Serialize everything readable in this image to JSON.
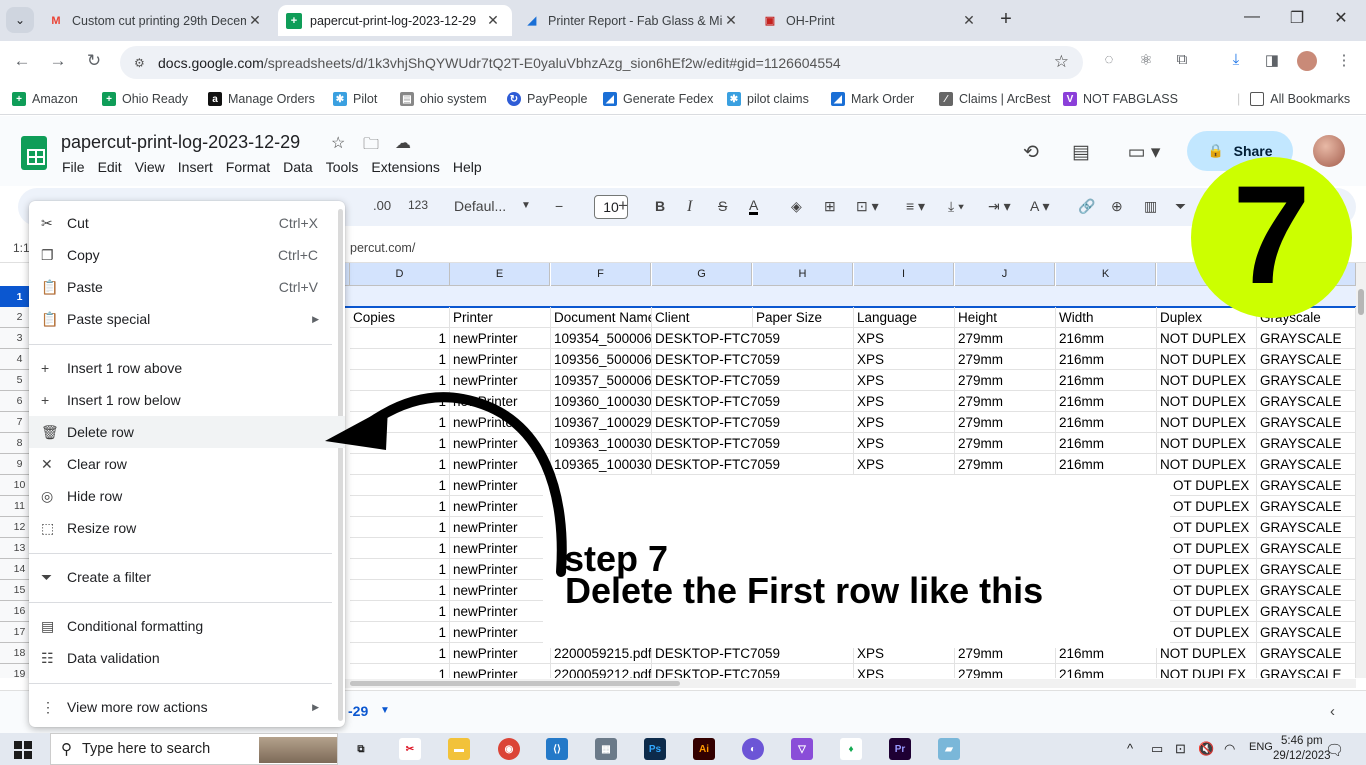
{
  "browser": {
    "tabs": [
      {
        "title": "Custom cut printing 29th Decem",
        "active": false
      },
      {
        "title": "papercut-print-log-2023-12-29",
        "active": true
      },
      {
        "title": "Printer Report - Fab Glass & Mi",
        "active": false
      },
      {
        "title": "OH-Print",
        "active": false
      }
    ],
    "address": {
      "host": "docs.google.com",
      "path": "/spreadsheets/d/1k3vhjShQYWUdr7tQ2T-E0yaluVbhzAzg_sion6hEf2w/edit#gid=1126604554"
    },
    "bookmarks": [
      "Amazon",
      "Ohio Ready",
      "Manage Orders",
      "Pilot",
      "ohio system",
      "PayPeople",
      "Generate Fedex",
      "pilot claims",
      "Mark Order",
      "Claims | ArcBest",
      "NOT FABGLASS"
    ],
    "all_bookmarks": "All Bookmarks"
  },
  "sheets": {
    "doc_title": "papercut-print-log-2023-12-29",
    "menu": [
      "File",
      "Edit",
      "View",
      "Insert",
      "Format",
      "Data",
      "Tools",
      "Extensions",
      "Help"
    ],
    "share_label": "Share",
    "toolbar": {
      "decimal": ".00",
      "number_format": "123",
      "font": "Defaul...",
      "font_size": "10"
    },
    "name_box": "1:1",
    "formula_text": "percut.com/",
    "columns": [
      "D",
      "E",
      "F",
      "G",
      "H",
      "I",
      "J",
      "K"
    ],
    "row_numbers": [
      "1",
      "2",
      "3",
      "4",
      "5",
      "6",
      "7",
      "8",
      "9",
      "10",
      "11",
      "12",
      "13",
      "14",
      "15",
      "16",
      "17",
      "18",
      "19"
    ],
    "header_row": [
      "Copies",
      "Printer",
      "Document Name",
      "Client",
      "Paper Size",
      "Language",
      "Height",
      "Width",
      "Duplex",
      "Grayscale"
    ],
    "full_rows": [
      [
        "1",
        "newPrinter",
        "109354_500006",
        "DESKTOP-FTC7059",
        "XPS",
        "279mm",
        "216mm",
        "NOT DUPLEX",
        "GRAYSCALE"
      ],
      [
        "1",
        "newPrinter",
        "109356_500006",
        "DESKTOP-FTC7059",
        "XPS",
        "279mm",
        "216mm",
        "NOT DUPLEX",
        "GRAYSCALE"
      ],
      [
        "1",
        "newPrinter",
        "109357_500006",
        "DESKTOP-FTC7059",
        "XPS",
        "279mm",
        "216mm",
        "NOT DUPLEX",
        "GRAYSCALE"
      ],
      [
        "1",
        "newPrinter",
        "109360_100030",
        "DESKTOP-FTC7059",
        "XPS",
        "279mm",
        "216mm",
        "NOT DUPLEX",
        "GRAYSCALE"
      ],
      [
        "1",
        "newPrinter",
        "109367_100029",
        "DESKTOP-FTC7059",
        "XPS",
        "279mm",
        "216mm",
        "NOT DUPLEX",
        "GRAYSCALE"
      ],
      [
        "1",
        "newPrinter",
        "109363_100030",
        "DESKTOP-FTC7059",
        "XPS",
        "279mm",
        "216mm",
        "NOT DUPLEX",
        "GRAYSCALE"
      ],
      [
        "1",
        "newPrinter",
        "109365_100030",
        "DESKTOP-FTC7059",
        "XPS",
        "279mm",
        "216mm",
        "NOT DUPLEX",
        "GRAYSCALE"
      ]
    ],
    "partial_rows": [
      [
        "1",
        "newPrinter",
        "OT DUPLEX",
        "GRAYSCALE"
      ],
      [
        "1",
        "newPrinter",
        "OT DUPLEX",
        "GRAYSCALE"
      ],
      [
        "1",
        "newPrinter",
        "OT DUPLEX",
        "GRAYSCALE"
      ],
      [
        "1",
        "newPrinter",
        "OT DUPLEX",
        "GRAYSCALE"
      ],
      [
        "1",
        "newPrinter",
        "OT DUPLEX",
        "GRAYSCALE"
      ],
      [
        "1",
        "newPrinter",
        "OT DUPLEX",
        "GRAYSCALE"
      ],
      [
        "1",
        "newPrinter",
        "OT DUPLEX",
        "GRAYSCALE"
      ],
      [
        "1",
        "newPrinter",
        "OT DUPLEX",
        "GRAYSCALE"
      ]
    ],
    "bottom_rows": [
      [
        "1",
        "newPrinter",
        "2200059215.pdf",
        "DESKTOP-FTC7059",
        "XPS",
        "279mm",
        "216mm",
        "NOT DUPLEX",
        "GRAYSCALE"
      ],
      [
        "1",
        "newPrinter",
        "2200059212.pdf",
        "DESKTOP-FTC7059",
        "XPS",
        "279mm",
        "216mm",
        "NOT DUPLEX",
        "GRAYSCALE"
      ]
    ],
    "sheet_tab": "-29"
  },
  "context_menu": {
    "items": [
      {
        "label": "Cut",
        "shortcut": "Ctrl+X",
        "icon": "cut-icon"
      },
      {
        "label": "Copy",
        "shortcut": "Ctrl+C",
        "icon": "copy-icon"
      },
      {
        "label": "Paste",
        "shortcut": "Ctrl+V",
        "icon": "paste-icon"
      },
      {
        "label": "Paste special",
        "shortcut": "",
        "icon": "paste-special-icon",
        "submenu": true
      },
      {
        "label": "Insert 1 row above",
        "shortcut": "",
        "icon": "plus-icon"
      },
      {
        "label": "Insert 1 row below",
        "shortcut": "",
        "icon": "plus-icon"
      },
      {
        "label": "Delete row",
        "shortcut": "",
        "icon": "trash-icon",
        "highlighted": true
      },
      {
        "label": "Clear row",
        "shortcut": "",
        "icon": "x-icon"
      },
      {
        "label": "Hide row",
        "shortcut": "",
        "icon": "eye-off-icon"
      },
      {
        "label": "Resize row",
        "shortcut": "",
        "icon": "resize-icon"
      },
      {
        "label": "Create a filter",
        "shortcut": "",
        "icon": "filter-icon"
      },
      {
        "label": "Conditional formatting",
        "shortcut": "",
        "icon": "paint-roller-icon"
      },
      {
        "label": "Data validation",
        "shortcut": "",
        "icon": "data-validation-icon"
      },
      {
        "label": "View more row actions",
        "shortcut": "",
        "icon": "more-vert-icon",
        "submenu": true
      }
    ]
  },
  "annotation": {
    "badge": "7",
    "step_title": "step 7",
    "step_desc": "Delete the First row like this"
  },
  "taskbar": {
    "search_placeholder": "Type here to search",
    "time": "5:46 pm",
    "date": "29/12/2023"
  },
  "colors": {
    "accent": "#0b57d0",
    "share_bg": "#c2e7ff",
    "badge": "#ccff00",
    "sheets_green": "#0f9d58"
  }
}
